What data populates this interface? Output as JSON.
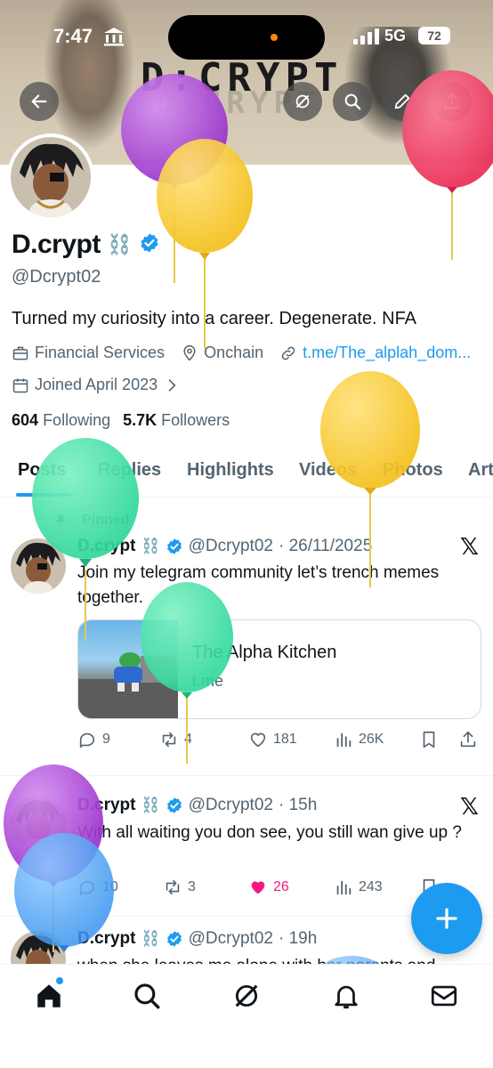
{
  "status_bar": {
    "time": "7:47",
    "network": "5G",
    "battery": "72"
  },
  "banner": {
    "title": "D:CRYPT"
  },
  "profile": {
    "name": "D.crypt",
    "name_emoji": "⛓️",
    "handle": "@Dcrypt02",
    "bio": "Turned my curiosity into a career. Degenerate. NFA",
    "category": "Financial Services",
    "location": "Onchain",
    "link": "t.me/The_alplah_dom...",
    "joined": "Joined April 2023",
    "following_count": "604",
    "following_label": "Following",
    "followers_count": "5.7K",
    "followers_label": "Followers"
  },
  "tabs": [
    "Posts",
    "Replies",
    "Highlights",
    "Videos",
    "Photos",
    "Art"
  ],
  "posts": [
    {
      "pinned_label": "Pinned",
      "name": "D.crypt",
      "emoji": "⛓️",
      "handle": "@Dcrypt02",
      "time": "· 26/11/2025",
      "text": "Join my telegram community let’s trench memes together.",
      "card": {
        "title": "The Alpha Kitchen",
        "domain": "t.me"
      },
      "replies": "9",
      "reposts": "4",
      "likes": "181",
      "views": "26K"
    },
    {
      "name": "D.crypt",
      "emoji": "⛓️",
      "handle": "@Dcrypt02",
      "time": "· 15h",
      "text": "With all waiting you don see, you still wan give up ?",
      "replies": "10",
      "reposts": "3",
      "likes": "26",
      "views": "243"
    },
    {
      "name": "D.crypt",
      "emoji": "⛓️",
      "handle": "@Dcrypt02",
      "time": "· 19h",
      "text": "when she leaves me alone with her parents and"
    }
  ],
  "icons": {
    "back": "back-arrow-icon",
    "grok": "grok-icon",
    "search": "search-icon",
    "edit": "edit-icon",
    "share": "share-icon",
    "verified": "verified-badge-icon",
    "x": "x-logo-icon",
    "compose": "plus-icon"
  },
  "colors": {
    "accent": "#1d9bf0",
    "like": "#f91880",
    "text": "#0f1419",
    "muted": "#536471"
  },
  "bottom_nav": [
    "home-icon",
    "search-icon",
    "grok-icon",
    "notifications-icon",
    "messages-icon"
  ]
}
